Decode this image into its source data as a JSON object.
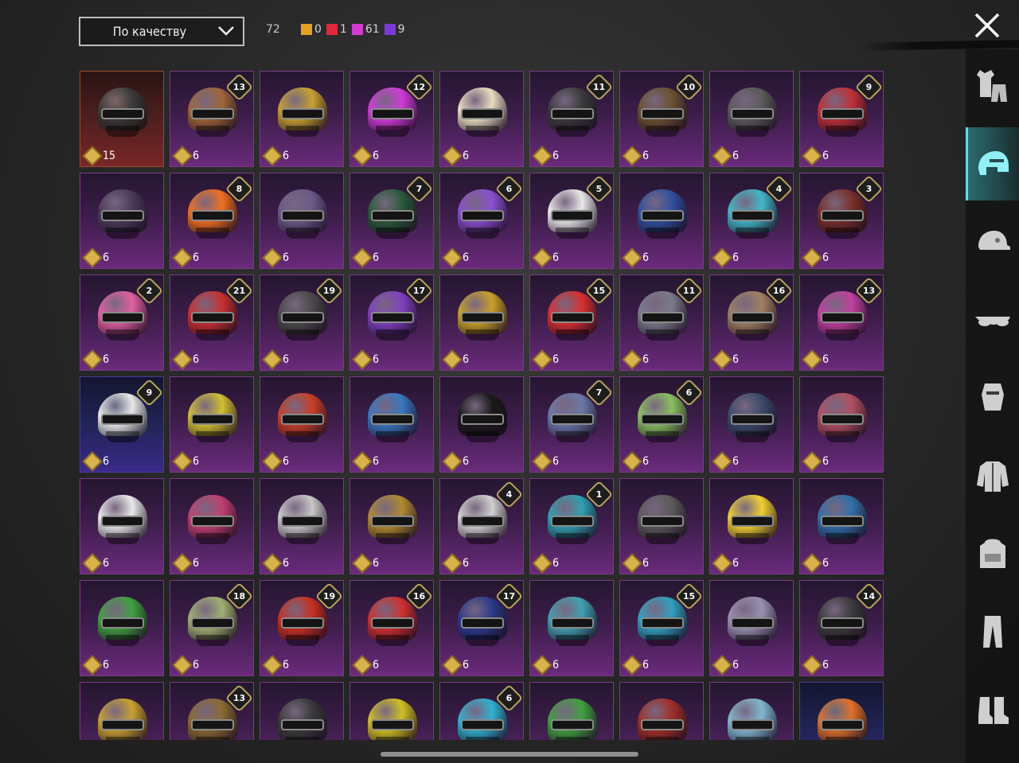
{
  "header": {
    "sort_label": "По качеству",
    "total_count": "72",
    "legend": [
      {
        "color": "#e6a023",
        "count": "0"
      },
      {
        "color": "#e0283a",
        "count": "1"
      },
      {
        "color": "#d23bd0",
        "count": "61"
      },
      {
        "color": "#7a3ad8",
        "count": "9"
      }
    ]
  },
  "sidebar": {
    "items": [
      {
        "icon": "outfit-icon",
        "active": false
      },
      {
        "icon": "helmet-icon",
        "active": true
      },
      {
        "icon": "cap-icon",
        "active": false
      },
      {
        "icon": "glasses-icon",
        "active": false
      },
      {
        "icon": "mask-icon",
        "active": false
      },
      {
        "icon": "jacket-icon",
        "active": false
      },
      {
        "icon": "backpack-icon",
        "active": false
      },
      {
        "icon": "pants-icon",
        "active": false
      },
      {
        "icon": "boots-icon",
        "active": false
      }
    ]
  },
  "items": [
    {
      "quality": "gold",
      "color": "#3a3a3a",
      "level": "",
      "cost": "15"
    },
    {
      "quality": "purple",
      "color": "#a0663a",
      "level": "13",
      "cost": "6"
    },
    {
      "quality": "purple",
      "color": "#c8a030",
      "level": "",
      "cost": "6"
    },
    {
      "quality": "purple",
      "color": "#d03bd8",
      "level": "12",
      "cost": "6"
    },
    {
      "quality": "purple",
      "color": "#e8dcc0",
      "level": "",
      "cost": "6"
    },
    {
      "quality": "purple",
      "color": "#3a3a3a",
      "level": "11",
      "cost": "6"
    },
    {
      "quality": "purple",
      "color": "#6a5030",
      "level": "10",
      "cost": "6"
    },
    {
      "quality": "purple",
      "color": "#5a5a5a",
      "level": "",
      "cost": "6"
    },
    {
      "quality": "purple",
      "color": "#c03038",
      "level": "9",
      "cost": "6"
    },
    {
      "quality": "purple",
      "color": "#4a3a5a",
      "level": "",
      "cost": "6"
    },
    {
      "quality": "purple",
      "color": "#f07020",
      "level": "8",
      "cost": "6"
    },
    {
      "quality": "purple",
      "color": "#6a5a8a",
      "level": "",
      "cost": "6"
    },
    {
      "quality": "purple",
      "color": "#2a5a3a",
      "level": "7",
      "cost": "6"
    },
    {
      "quality": "purple",
      "color": "#8a50d0",
      "level": "6",
      "cost": "6"
    },
    {
      "quality": "purple",
      "color": "#e8e8e8",
      "level": "5",
      "cost": "6"
    },
    {
      "quality": "purple",
      "color": "#3050a0",
      "level": "",
      "cost": "6"
    },
    {
      "quality": "purple",
      "color": "#40b8c8",
      "level": "4",
      "cost": "6"
    },
    {
      "quality": "purple",
      "color": "#7a3028",
      "level": "3",
      "cost": "6"
    },
    {
      "quality": "purple",
      "color": "#e060a0",
      "level": "2",
      "cost": "6"
    },
    {
      "quality": "purple",
      "color": "#c83030",
      "level": "21",
      "cost": "6"
    },
    {
      "quality": "purple",
      "color": "#4a4a4a",
      "level": "19",
      "cost": "6"
    },
    {
      "quality": "purple",
      "color": "#8040c0",
      "level": "17",
      "cost": "6"
    },
    {
      "quality": "purple",
      "color": "#c8a028",
      "level": "",
      "cost": "6"
    },
    {
      "quality": "purple",
      "color": "#d83030",
      "level": "15",
      "cost": "6"
    },
    {
      "quality": "purple",
      "color": "#7a7a8a",
      "level": "11",
      "cost": "6"
    },
    {
      "quality": "purple",
      "color": "#a08060",
      "level": "16",
      "cost": "6"
    },
    {
      "quality": "purple",
      "color": "#c040a0",
      "level": "13",
      "cost": "6"
    },
    {
      "quality": "blue",
      "color": "#e8e8e8",
      "level": "9",
      "cost": "6"
    },
    {
      "quality": "purple",
      "color": "#d0c030",
      "level": "",
      "cost": "6"
    },
    {
      "quality": "purple",
      "color": "#c84028",
      "level": "",
      "cost": "6"
    },
    {
      "quality": "purple",
      "color": "#3878c0",
      "level": "",
      "cost": "6"
    },
    {
      "quality": "purple",
      "color": "#1a1a1a",
      "level": "",
      "cost": "6"
    },
    {
      "quality": "purple",
      "color": "#6a78a8",
      "level": "7",
      "cost": "6"
    },
    {
      "quality": "purple",
      "color": "#8ac060",
      "level": "6",
      "cost": "6"
    },
    {
      "quality": "purple",
      "color": "#3a4a6a",
      "level": "",
      "cost": "6"
    },
    {
      "quality": "purple",
      "color": "#b05060",
      "level": "",
      "cost": "6"
    },
    {
      "quality": "purple",
      "color": "#e8e8e8",
      "level": "",
      "cost": "6"
    },
    {
      "quality": "purple",
      "color": "#c04070",
      "level": "",
      "cost": "6"
    },
    {
      "quality": "purple",
      "color": "#c8c8c8",
      "level": "",
      "cost": "6"
    },
    {
      "quality": "purple",
      "color": "#b08a30",
      "level": "",
      "cost": "6"
    },
    {
      "quality": "purple",
      "color": "#d0d0d0",
      "level": "4",
      "cost": "6"
    },
    {
      "quality": "purple",
      "color": "#30a0b0",
      "level": "1",
      "cost": "6"
    },
    {
      "quality": "purple",
      "color": "#5a5a5a",
      "level": "",
      "cost": "6"
    },
    {
      "quality": "purple",
      "color": "#f0d030",
      "level": "",
      "cost": "6"
    },
    {
      "quality": "purple",
      "color": "#3070a8",
      "level": "",
      "cost": "6"
    },
    {
      "quality": "purple",
      "color": "#40a040",
      "level": "",
      "cost": "6"
    },
    {
      "quality": "purple",
      "color": "#a0b070",
      "level": "18",
      "cost": "6"
    },
    {
      "quality": "purple",
      "color": "#c83020",
      "level": "19",
      "cost": "6"
    },
    {
      "quality": "purple",
      "color": "#d03030",
      "level": "16",
      "cost": "6"
    },
    {
      "quality": "purple",
      "color": "#2a3a8a",
      "level": "17",
      "cost": "6"
    },
    {
      "quality": "purple",
      "color": "#40a0b0",
      "level": "",
      "cost": "6"
    },
    {
      "quality": "purple",
      "color": "#30a0c0",
      "level": "15",
      "cost": "6"
    },
    {
      "quality": "purple",
      "color": "#9890b0",
      "level": "",
      "cost": "6"
    },
    {
      "quality": "purple",
      "color": "#3a3a3a",
      "level": "14",
      "cost": "6"
    },
    {
      "quality": "purple",
      "color": "#c8a030",
      "level": "",
      "cost": ""
    },
    {
      "quality": "purple",
      "color": "#8a6a30",
      "level": "13",
      "cost": ""
    },
    {
      "quality": "purple",
      "color": "#3a3a3a",
      "level": "",
      "cost": ""
    },
    {
      "quality": "purple",
      "color": "#d0c020",
      "level": "",
      "cost": ""
    },
    {
      "quality": "purple",
      "color": "#30b0d0",
      "level": "6",
      "cost": ""
    },
    {
      "quality": "purple",
      "color": "#40a040",
      "level": "",
      "cost": ""
    },
    {
      "quality": "purple",
      "color": "#a03028",
      "level": "",
      "cost": ""
    },
    {
      "quality": "purple",
      "color": "#80b8d0",
      "level": "",
      "cost": ""
    },
    {
      "quality": "blue",
      "color": "#e07028",
      "level": "",
      "cost": ""
    }
  ]
}
